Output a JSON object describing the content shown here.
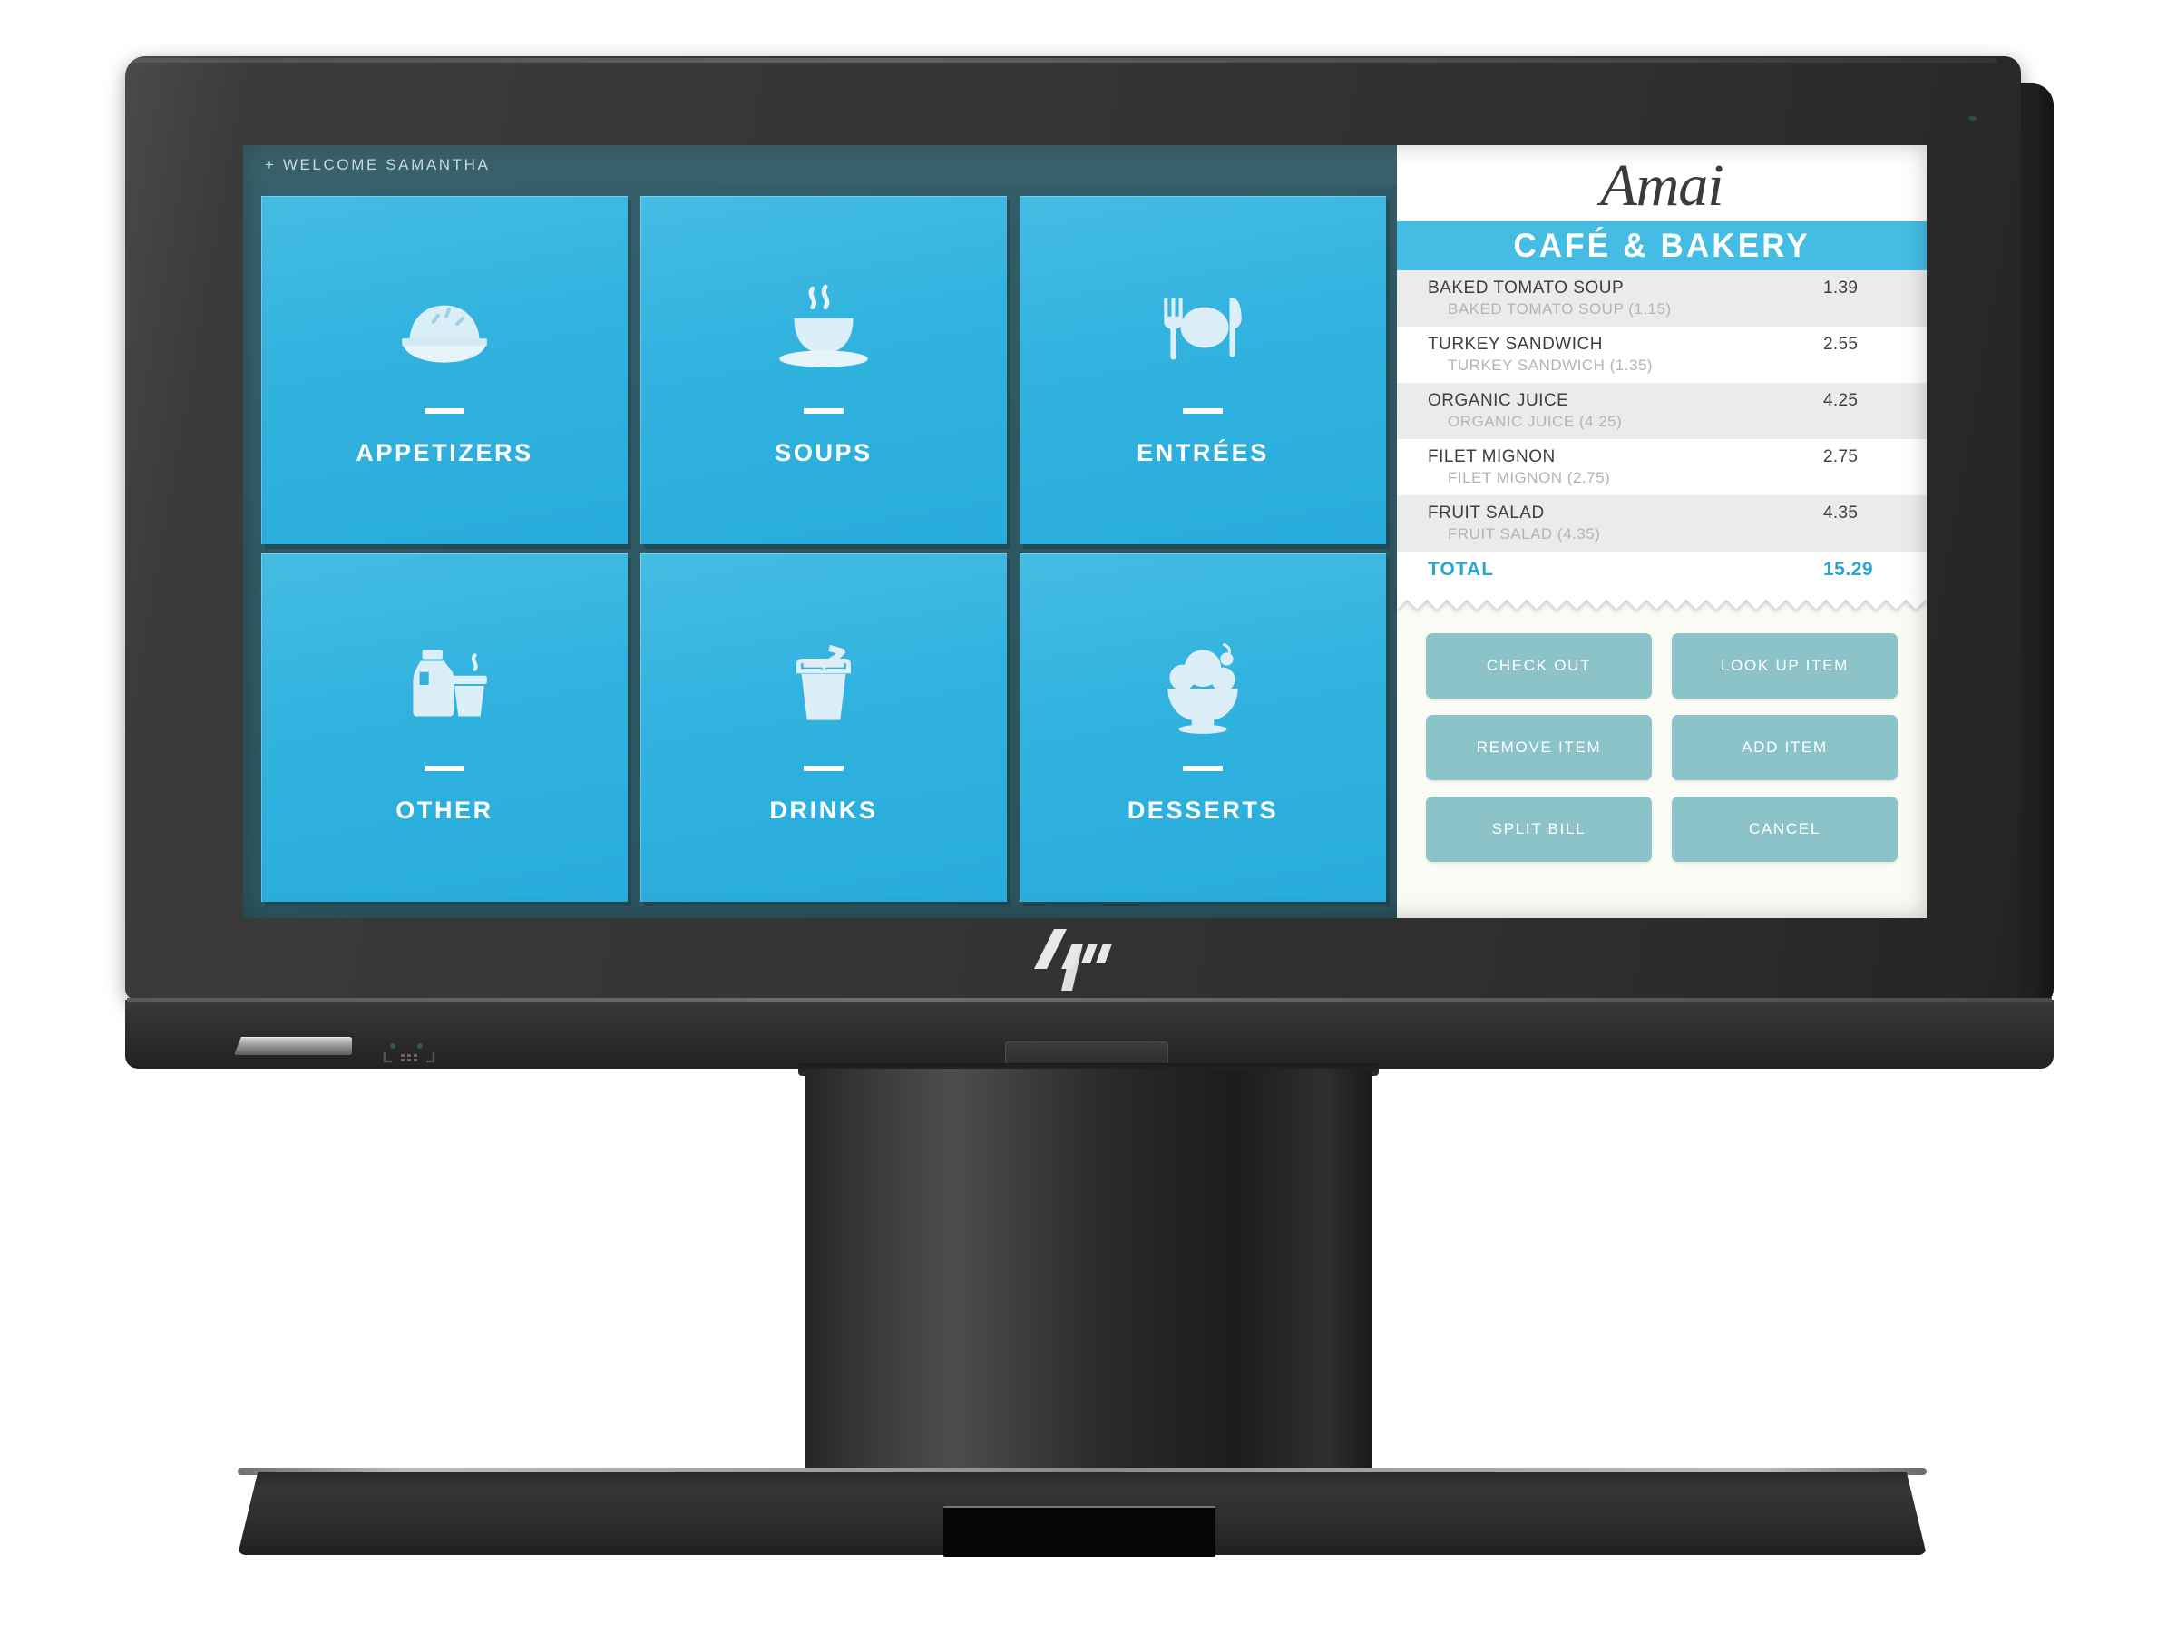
{
  "device": {
    "brand": "HP",
    "logo_name": "hp-logo",
    "bezel_color": "#323232",
    "chin_elements": [
      "card-reader-slot",
      "nfc-contactless-icon",
      "center-port"
    ]
  },
  "screen": {
    "header": {
      "welcome_text": "+ WELCOME SAMANTHA"
    },
    "categories": [
      {
        "label": "APPETIZERS",
        "icon": "pie-dish-icon"
      },
      {
        "label": "SOUPS",
        "icon": "soup-cup-icon"
      },
      {
        "label": "ENTRÉES",
        "icon": "fork-plate-knife-icon"
      },
      {
        "label": "OTHER",
        "icon": "milk-jug-coffee-cup-icon"
      },
      {
        "label": "DRINKS",
        "icon": "glass-straw-icon"
      },
      {
        "label": "DESSERTS",
        "icon": "ice-cream-sundae-icon"
      }
    ],
    "receipt": {
      "brand_script": "Amai",
      "brand_subtitle": "CAFÉ & BAKERY",
      "items": [
        {
          "name": "BAKED TOMATO SOUP",
          "price": "1.39",
          "sub": "BAKED TOMATO SOUP (1.15)"
        },
        {
          "name": "TURKEY SANDWICH",
          "price": "2.55",
          "sub": "TURKEY SANDWICH (1.35)"
        },
        {
          "name": "ORGANIC JUICE",
          "price": "4.25",
          "sub": "ORGANIC JUICE (4.25)"
        },
        {
          "name": "FILET MIGNON",
          "price": "2.75",
          "sub": "FILET MIGNON (2.75)"
        },
        {
          "name": "FRUIT SALAD",
          "price": "4.35",
          "sub": "FRUIT SALAD (4.35)"
        }
      ],
      "total_label": "TOTAL",
      "total_value": "15.29"
    },
    "actions": [
      {
        "label": "CHECK OUT"
      },
      {
        "label": "LOOK UP ITEM"
      },
      {
        "label": "REMOVE ITEM"
      },
      {
        "label": "ADD ITEM"
      },
      {
        "label": "SPLIT BILL"
      },
      {
        "label": "CANCEL"
      }
    ]
  },
  "colors": {
    "tile_cyan": "#32b3df",
    "brand_band": "#45bce4",
    "accent_total": "#2ba6d4",
    "button_teal": "#8cc3c8",
    "panel_bg": "#fbfbf6",
    "screen_bg": "#2e5963"
  }
}
